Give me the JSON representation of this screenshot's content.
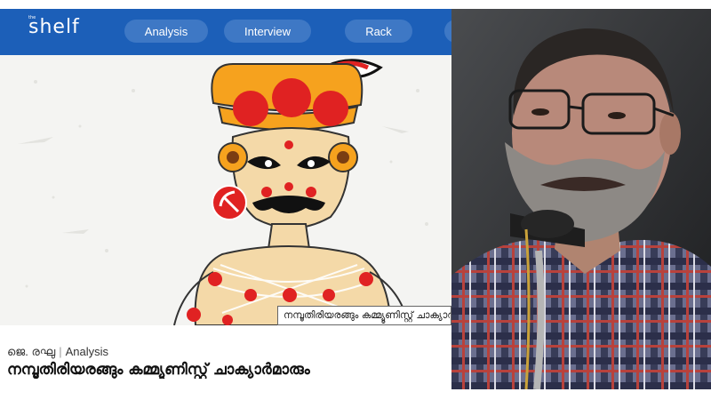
{
  "header": {
    "logo_text": "shelf",
    "logo_small": "the",
    "nav": [
      "Analysis",
      "Interview",
      "Rack"
    ]
  },
  "hero": {
    "tooltip": "നമ്പൂതിരിയരങ്ങും കമ്മ്യൂണിസ്റ്റ് ചാക്യാർമാരും"
  },
  "article": {
    "author": "ജെ. രഘു",
    "separator": "|",
    "category": "Analysis",
    "title": "നമ്പൂതിരിയരങ്ങും കമ്മ്യൂണിസ്റ്റ് ചാക്യാർമാരും"
  },
  "colors": {
    "header": "#1c5fb8",
    "nav_pill": "#3e78c5",
    "accent_red": "#e02222"
  }
}
